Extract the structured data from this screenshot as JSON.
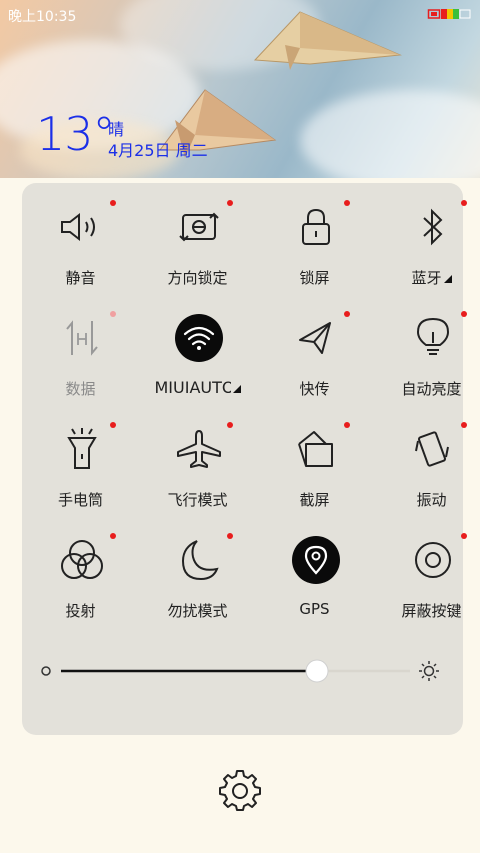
{
  "status_bar": {
    "time": "晚上10:35"
  },
  "weather": {
    "temperature": "13°",
    "condition": "晴",
    "date": "4月25日 周二"
  },
  "quick_settings": {
    "tiles": [
      {
        "label": "静音",
        "icon": "speaker-icon",
        "active": false
      },
      {
        "label": "方向锁定",
        "icon": "rotation-lock-icon",
        "active": false
      },
      {
        "label": "锁屏",
        "icon": "lock-icon",
        "active": false
      },
      {
        "label": "蓝牙",
        "icon": "bluetooth-icon",
        "active": false,
        "has_dropdown": true
      },
      {
        "label": "数据",
        "icon": "mobile-data-icon",
        "active": false,
        "disabled": true
      },
      {
        "label": "MIUIAUTO",
        "icon": "wifi-icon",
        "active": true,
        "has_dropdown": true
      },
      {
        "label": "快传",
        "icon": "paper-plane-icon",
        "active": false
      },
      {
        "label": "自动亮度",
        "icon": "bulb-icon",
        "active": false
      },
      {
        "label": "手电筒",
        "icon": "flashlight-icon",
        "active": false
      },
      {
        "label": "飞行模式",
        "icon": "airplane-icon",
        "active": false
      },
      {
        "label": "截屏",
        "icon": "screenshot-icon",
        "active": false
      },
      {
        "label": "振动",
        "icon": "vibrate-icon",
        "active": false
      },
      {
        "label": "投射",
        "icon": "cast-icon",
        "active": false
      },
      {
        "label": "勿扰模式",
        "icon": "moon-icon",
        "active": false
      },
      {
        "label": "GPS",
        "icon": "location-icon",
        "active": true
      },
      {
        "label": "屏蔽按键",
        "icon": "button-block-icon",
        "active": false
      }
    ]
  },
  "brightness": {
    "level": 0.7
  },
  "colors": {
    "accent": "#1b2fe8",
    "panel": "#e3e1da",
    "dot": "#e81d1d"
  }
}
